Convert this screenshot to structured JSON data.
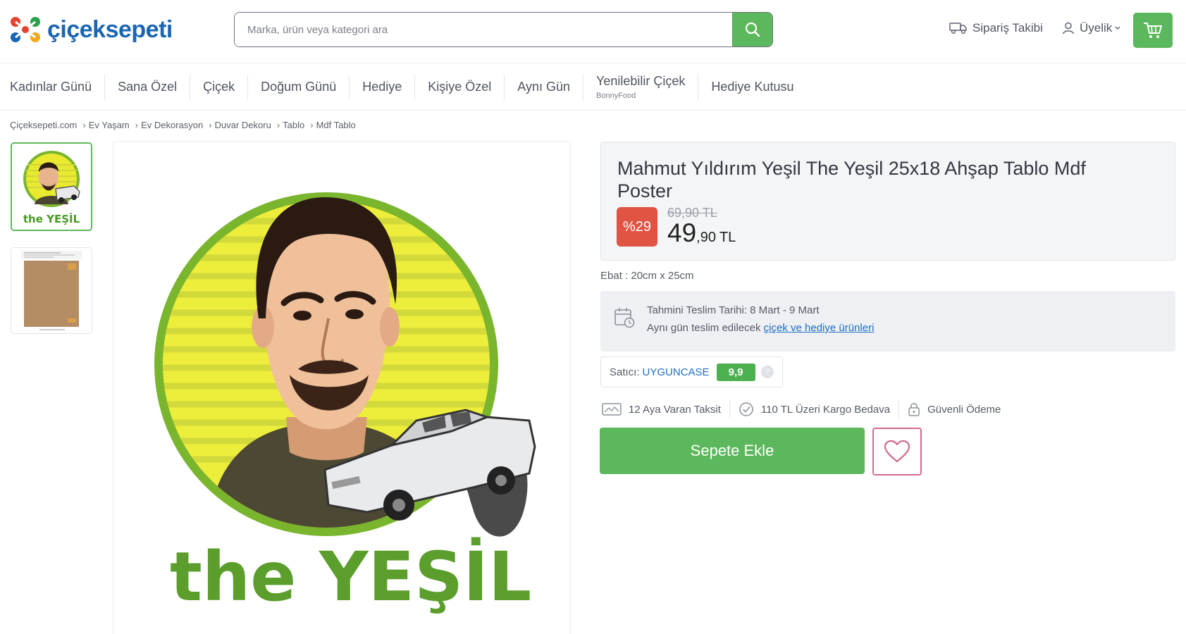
{
  "header": {
    "logo_text": "çiçeksepeti",
    "search_placeholder": "Marka, ürün veya kategori ara",
    "order_tracking": "Sipariş Takibi",
    "membership": "Üyelik",
    "icons": [
      "search-icon",
      "truck-icon",
      "user-icon",
      "chevron-down-icon",
      "cart-icon"
    ]
  },
  "nav": {
    "items": [
      {
        "label": "Kadınlar Günü",
        "sub": ""
      },
      {
        "label": "Sana Özel",
        "sub": ""
      },
      {
        "label": "Çiçek",
        "sub": ""
      },
      {
        "label": "Doğum Günü",
        "sub": ""
      },
      {
        "label": "Hediye",
        "sub": ""
      },
      {
        "label": "Kişiye Özel",
        "sub": ""
      },
      {
        "label": "Aynı Gün",
        "sub": ""
      },
      {
        "label": "Yenilebilir Çiçek",
        "sub": "BonnyFood"
      },
      {
        "label": "Hediye Kutusu",
        "sub": ""
      }
    ]
  },
  "breadcrumb": [
    "Çiçeksepeti.com",
    "Ev Yaşam",
    "Ev Dekorasyon",
    "Duvar Dekoru",
    "Tablo",
    "Mdf Tablo"
  ],
  "gallery": {
    "image_text_the": "the",
    "image_text_main": "YEŞİL",
    "thumb_text": "the YEŞİL"
  },
  "product": {
    "title": "Mahmut Yıldırım Yeşil The Yeşil 25x18 Ahşap Tablo Mdf Poster",
    "discount": "%29",
    "old_price": "69,90 TL",
    "price_int": "49",
    "price_dec": ",90",
    "currency": "TL",
    "size": "Ebat : 20cm x 25cm"
  },
  "delivery": {
    "estimate_label": "Tahmini Teslim Tarihi:",
    "estimate_value": "8 Mart - 9 Mart",
    "same_day_text": "Aynı gün teslim edilecek",
    "same_day_link": "çiçek ve hediye ürünleri"
  },
  "seller": {
    "label": "Satıcı:",
    "name": "UYGUNCASE",
    "score": "9,9",
    "help": "?"
  },
  "features": [
    "12 Aya Varan Taksit",
    "110 TL Üzeri Kargo Bedava",
    "Güvenli Ödeme"
  ],
  "actions": {
    "add_to_cart": "Sepete Ekle"
  },
  "colors": {
    "brand_blue": "#1b66b3",
    "accent_green": "#5cb85c",
    "discount_red": "#e05443",
    "favorite_pink": "#d06b8a"
  }
}
